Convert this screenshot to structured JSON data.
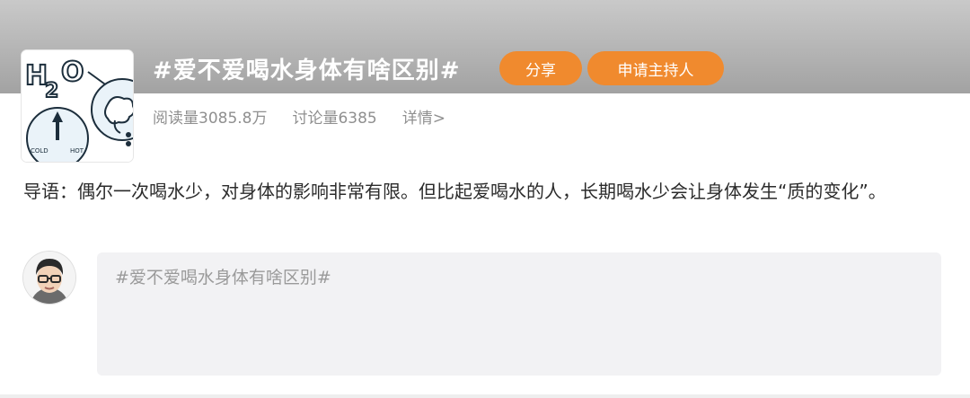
{
  "topic": {
    "title": "#爱不爱喝水身体有啥区别#",
    "share_label": "分享",
    "host_label": "申请主持人",
    "reads": "阅读量3085.8万",
    "discussions": "讨论量6385",
    "details_link": "详情>"
  },
  "thumbnail": {
    "formula_text": "H2O",
    "gauge_cold": "COLD",
    "gauge_hot": "HOT"
  },
  "intro": {
    "text": "导语：偶尔一次喝水少，对身体的影响非常有限。但比起爱喝水的人，长期喝水少会让身体发生“质的变化”。"
  },
  "composer": {
    "text": "#爱不爱喝水身体有啥区别#"
  },
  "colors": {
    "accent": "#f08a2e",
    "banner": "#b4b4b4",
    "composer_bg": "#f2f2f4"
  }
}
